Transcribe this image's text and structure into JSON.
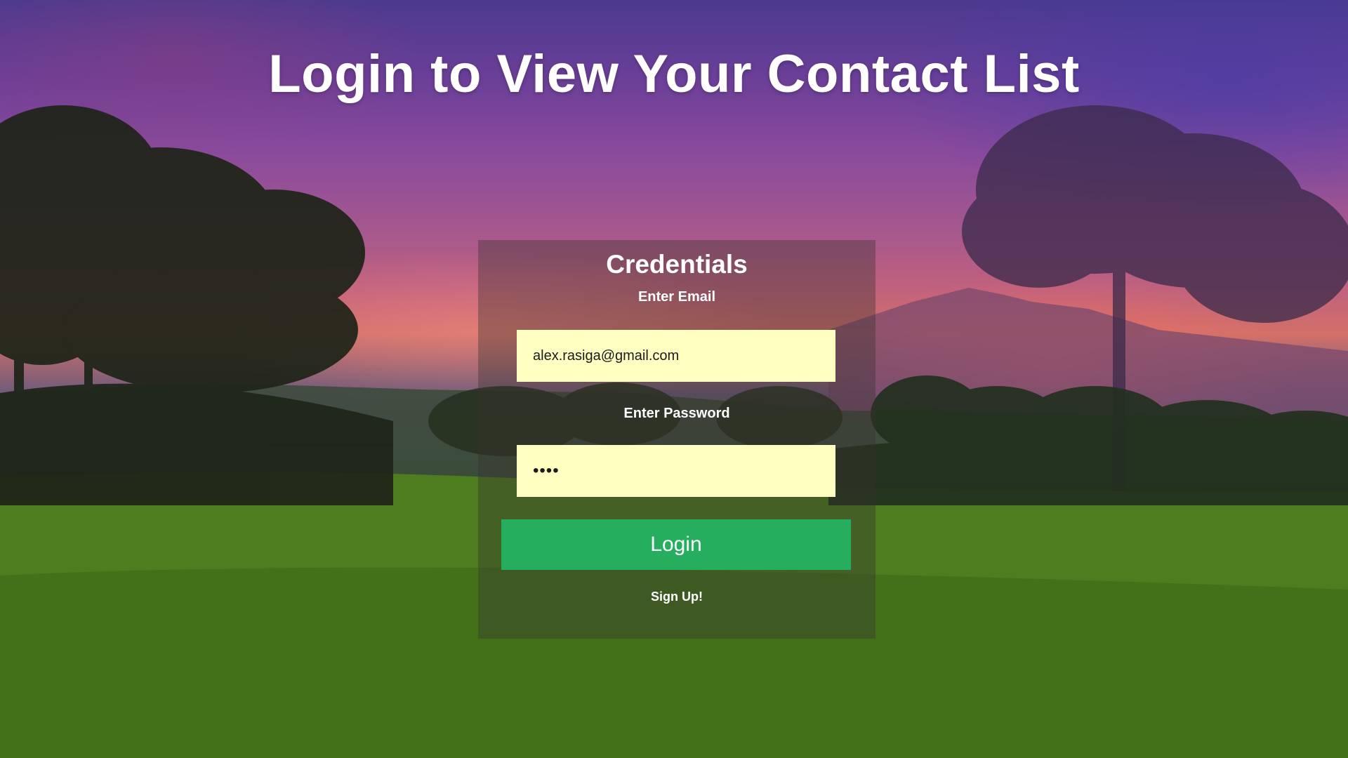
{
  "page": {
    "title": "Login to View Your Contact List"
  },
  "form": {
    "heading": "Credentials",
    "email_label": "Enter Email",
    "email_value": "alex.rasiga@gmail.com",
    "password_label": "Enter Password",
    "password_value": "1234",
    "login_button_label": "Login",
    "signup_link_label": "Sign Up!"
  },
  "colors": {
    "input_background": "#ffffc2",
    "login_button": "#26ae5f",
    "text": "#ffffff"
  }
}
